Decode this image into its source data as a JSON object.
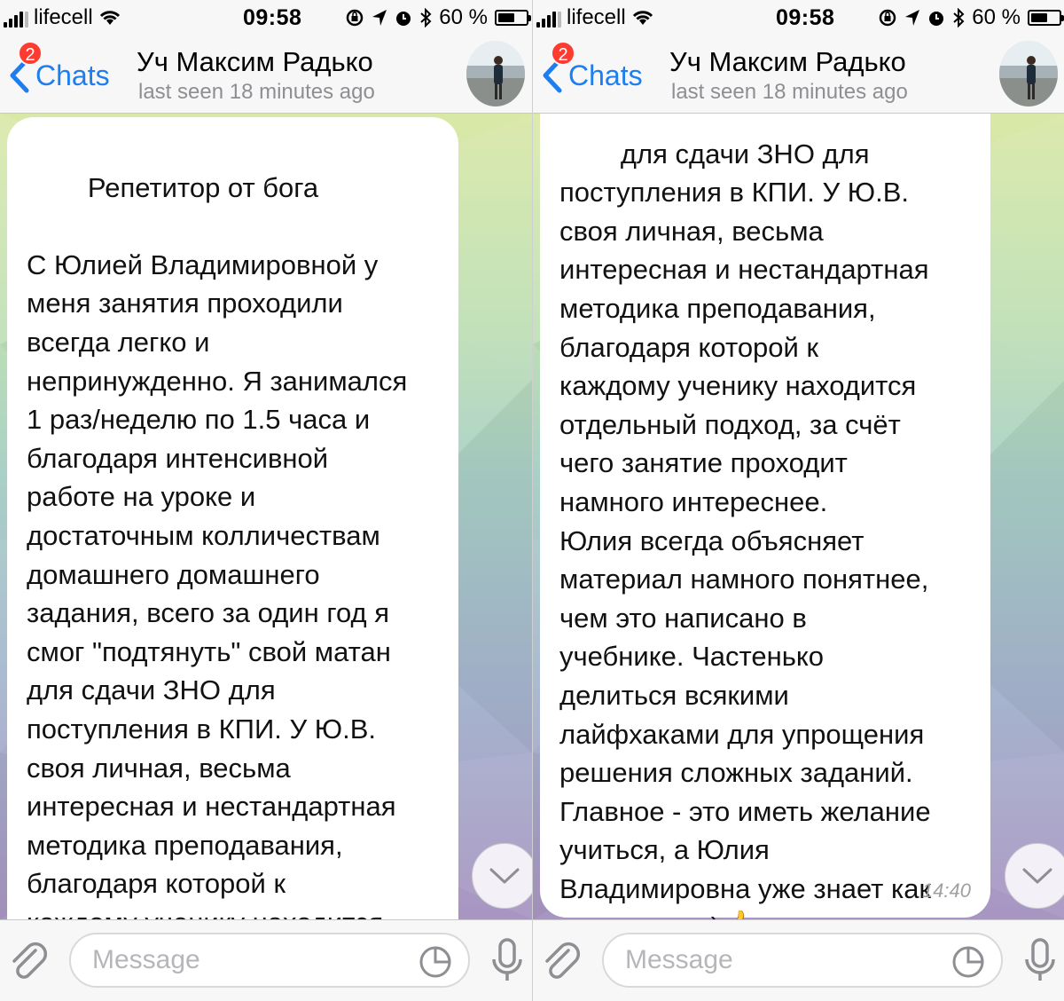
{
  "status": {
    "carrier": "lifecell",
    "time": "09:58",
    "battery": "60 %",
    "battery_level": 0.6
  },
  "header": {
    "back_label": "Chats",
    "unread_badge": "2",
    "title": "Уч Максим Радько",
    "subtitle": "last seen 18 minutes ago"
  },
  "left_message": {
    "text": "Репетитор от бога\n\nС Юлией Владимировной у\nменя занятия проходили\nвсегда легко и\nнепринужденно. Я занимался\n1 раз/неделю по 1.5 часа и\nблагодаря интенсивной\nработе на уроке и\nдостаточным колличествам\nдомашнего домашнего\nзадания, всего за один год я\nсмог \"подтянуть\" свой матан\nдля сдачи ЗНО для\nпоступления в КПИ. У Ю.В.\nсвоя личная, весьма\nинтересная и нестандартная\nметодика преподавания,\nблагодаря которой к\nкаждому ученику находится\nотдельный подход, за счёт"
  },
  "right_message": {
    "text": "для сдачи ЗНО для\nпоступления в КПИ. У Ю.В.\nсвоя личная, весьма\nинтересная и нестандартная\nметодика преподавания,\nблагодаря которой к\nкаждому ученику находится\nотдельный подход, за счёт\nчего занятие проходит\nнамного интереснее.\nЮлия всегда объясняет\nматериал намного понятнее,\nчем это написано в\nучебнике. Частенько\nделиться всякими\nлайфхаками для упрощения\nрешения сложных заданий.\nГлавное - это иметь желание\nучиться, а Юлия\nВладимировна уже знает как\nвас научить)",
    "emoji": "👍",
    "time": "14:40"
  },
  "input": {
    "placeholder": "Message"
  },
  "icons": {
    "back": "chevron-left-icon",
    "attach": "paperclip-icon",
    "sticker": "sticker-icon",
    "mic": "microphone-icon",
    "scroll": "chevron-down-icon"
  },
  "colors": {
    "accent": "#1e7ef0",
    "badge": "#fd3b30",
    "secondary_text": "#8e8e93"
  }
}
